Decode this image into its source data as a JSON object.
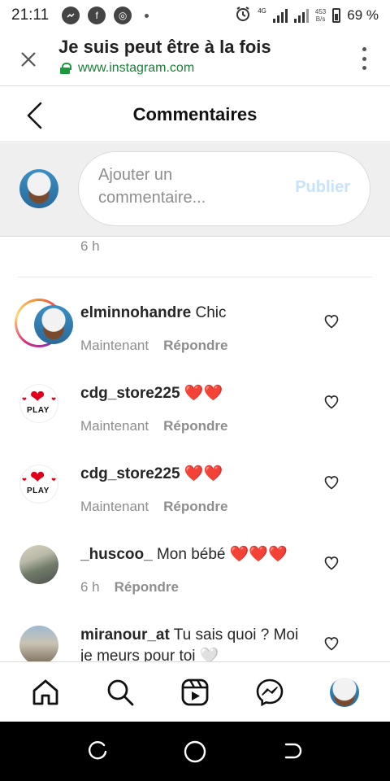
{
  "status_bar": {
    "time": "21:11",
    "network_type": "4G",
    "net_speed_value": "453",
    "net_speed_unit": "B/s",
    "battery": "69 %"
  },
  "browser": {
    "page_title": "Je suis peut être à la fois",
    "url": "www.instagram.com"
  },
  "header": {
    "title": "Commentaires"
  },
  "composer": {
    "placeholder": "Ajouter un commentaire...",
    "publish_label": "Publier"
  },
  "previous_time": "6 h",
  "comments": [
    {
      "username": "elminnohandre",
      "text": "Chic",
      "time": "Maintenant",
      "reply_label": "Répondre"
    },
    {
      "username": "cdg_store225",
      "text": "❤️❤️",
      "time": "Maintenant",
      "reply_label": "Répondre"
    },
    {
      "username": "cdg_store225",
      "text": "❤️❤️",
      "time": "Maintenant",
      "reply_label": "Répondre"
    },
    {
      "username": "_huscoo_",
      "text": "Mon bébé ❤️❤️❤️",
      "time": "6 h",
      "reply_label": "Répondre"
    },
    {
      "username": "miranour_at",
      "text": "Tu sais quoi ? Moi je meurs pour toi 🤍",
      "time": "",
      "reply_label": ""
    }
  ],
  "cdg_avatar_text": "PLAY",
  "icons": {
    "bottom_nav": [
      "home-icon",
      "search-icon",
      "reels-icon",
      "messenger-icon",
      "profile-avatar"
    ],
    "android_nav": [
      "recents-icon",
      "home-circle-icon",
      "back-icon"
    ]
  },
  "colors": {
    "instagram_link_disabled": "#c6e3fb",
    "secure_url_green": "#1a7f37",
    "secondary_text": "#8e8e8e"
  }
}
